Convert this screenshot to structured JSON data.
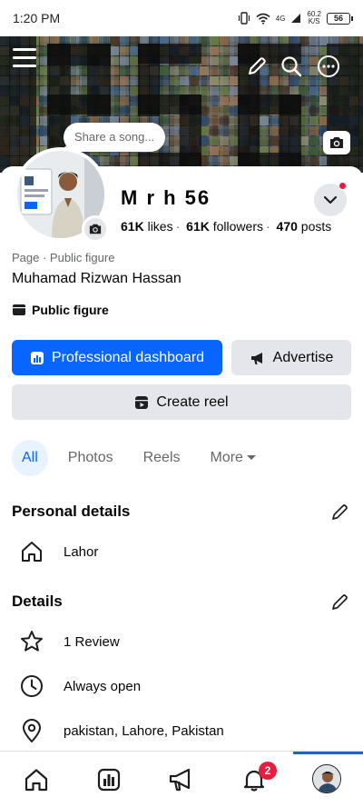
{
  "status_bar": {
    "time": "1:20 PM",
    "network": "4G",
    "speed": "60.2",
    "speed_unit": "K/S",
    "battery": "56"
  },
  "header": {
    "menu_icon": "menu-icon",
    "edit_icon": "pencil-icon",
    "search_icon": "search-icon",
    "more_icon": "more-icon"
  },
  "cover": {
    "share_song": "Share a song..."
  },
  "profile": {
    "name": "M r h 56",
    "likes": "61K",
    "likes_label": "likes",
    "followers": "61K",
    "followers_label": "followers",
    "posts": "470",
    "posts_label": "posts",
    "category": "Page · Public figure",
    "full_name": "Muhamad Rizwan Hassan",
    "public_figure": "Public figure"
  },
  "actions": {
    "dashboard": "Professional dashboard",
    "advertise": "Advertise",
    "create_reel": "Create reel"
  },
  "tabs": [
    {
      "label": "All",
      "active": true
    },
    {
      "label": "Photos",
      "active": false
    },
    {
      "label": "Reels",
      "active": false
    },
    {
      "label": "More",
      "active": false
    }
  ],
  "personal_details": {
    "title": "Personal details",
    "location": "Lahor"
  },
  "details": {
    "title": "Details",
    "review": "1 Review",
    "hours": "Always open",
    "address": "pakistan, Lahore, Pakistan"
  },
  "bottom_nav": {
    "notification_count": "2"
  },
  "colors": {
    "accent": "#0866ff",
    "badge": "#e41e3f",
    "button_grey": "#e4e6eb",
    "tab_bg": "#e7f3ff"
  }
}
